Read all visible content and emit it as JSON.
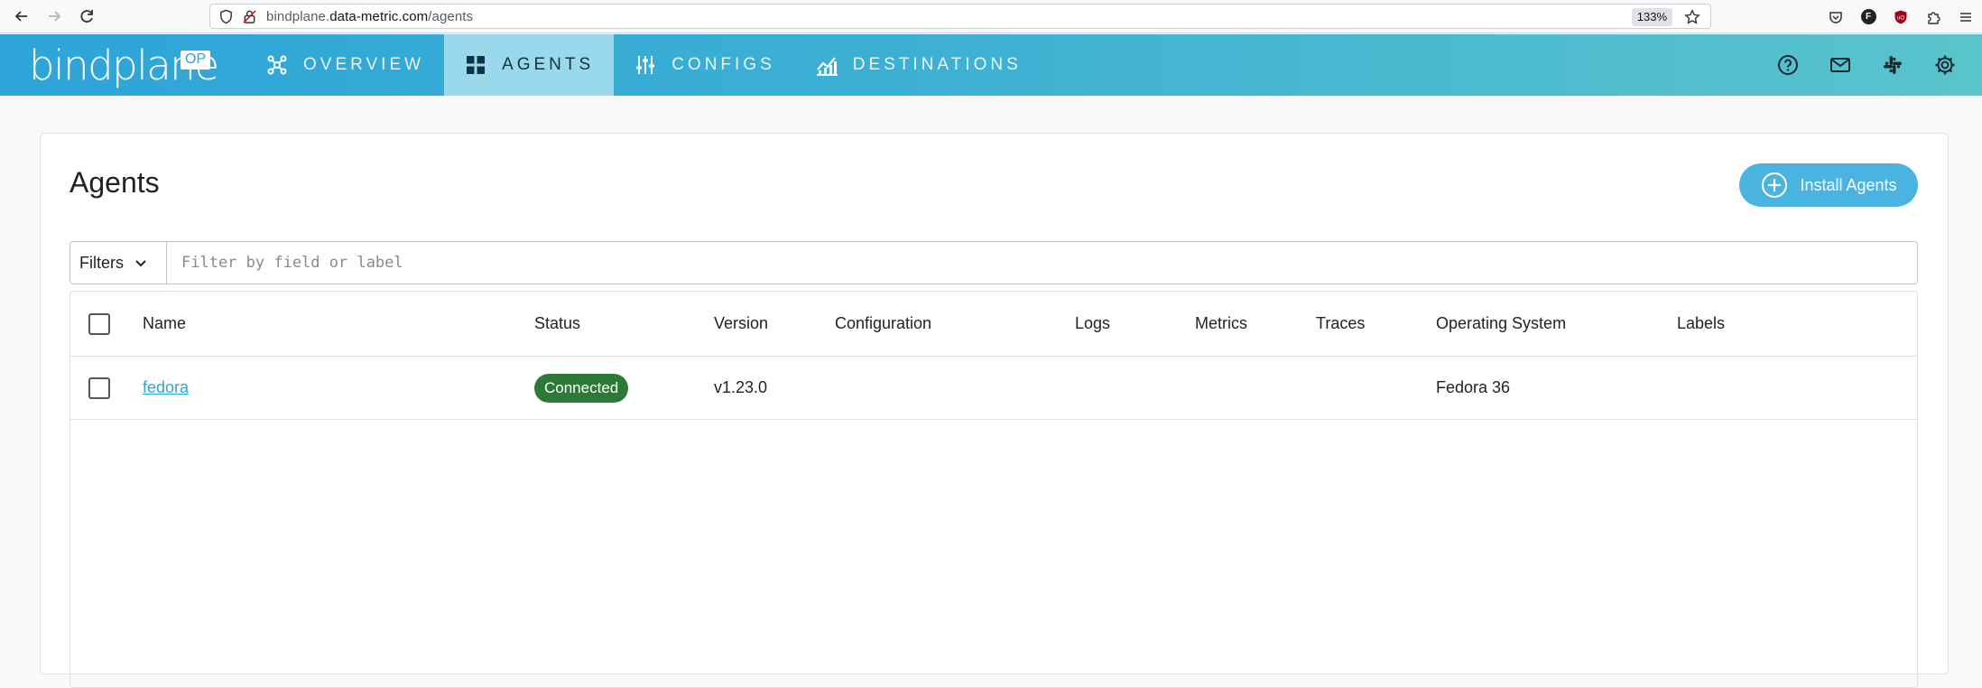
{
  "browser": {
    "url_host_prefix": "bindplane.",
    "url_host": "data-metric.com",
    "url_path": "/agents",
    "zoom": "133%"
  },
  "header": {
    "logo_text": "bindplane",
    "logo_badge": "OP",
    "nav": [
      {
        "label": "OVERVIEW",
        "icon": "overview-icon"
      },
      {
        "label": "AGENTS",
        "icon": "agents-grid-icon"
      },
      {
        "label": "CONFIGS",
        "icon": "configs-sliders-icon"
      },
      {
        "label": "DESTINATIONS",
        "icon": "destinations-chart-icon"
      }
    ],
    "active_nav": "AGENTS",
    "right_icons": [
      "help-icon",
      "mail-icon",
      "slack-icon",
      "settings-icon"
    ]
  },
  "page": {
    "title": "Agents",
    "install_button": "Install Agents"
  },
  "filters": {
    "select_label": "Filters",
    "placeholder": "Filter by field or label"
  },
  "table": {
    "columns": [
      "Name",
      "Status",
      "Version",
      "Configuration",
      "Logs",
      "Metrics",
      "Traces",
      "Operating System",
      "Labels"
    ],
    "rows": [
      {
        "name": "fedora",
        "status": "Connected",
        "version": "v1.23.0",
        "configuration": "",
        "logs": "",
        "metrics": "",
        "traces": "",
        "os": "Fedora 36",
        "labels": ""
      }
    ]
  },
  "colors": {
    "header_gradient_start": "#2ea4d8",
    "header_gradient_end": "#5ac4cc",
    "active_tab": "#9ad8eb",
    "primary_button": "#4bb3e0",
    "status_connected": "#2c7a36",
    "link": "#2ea4d8"
  }
}
